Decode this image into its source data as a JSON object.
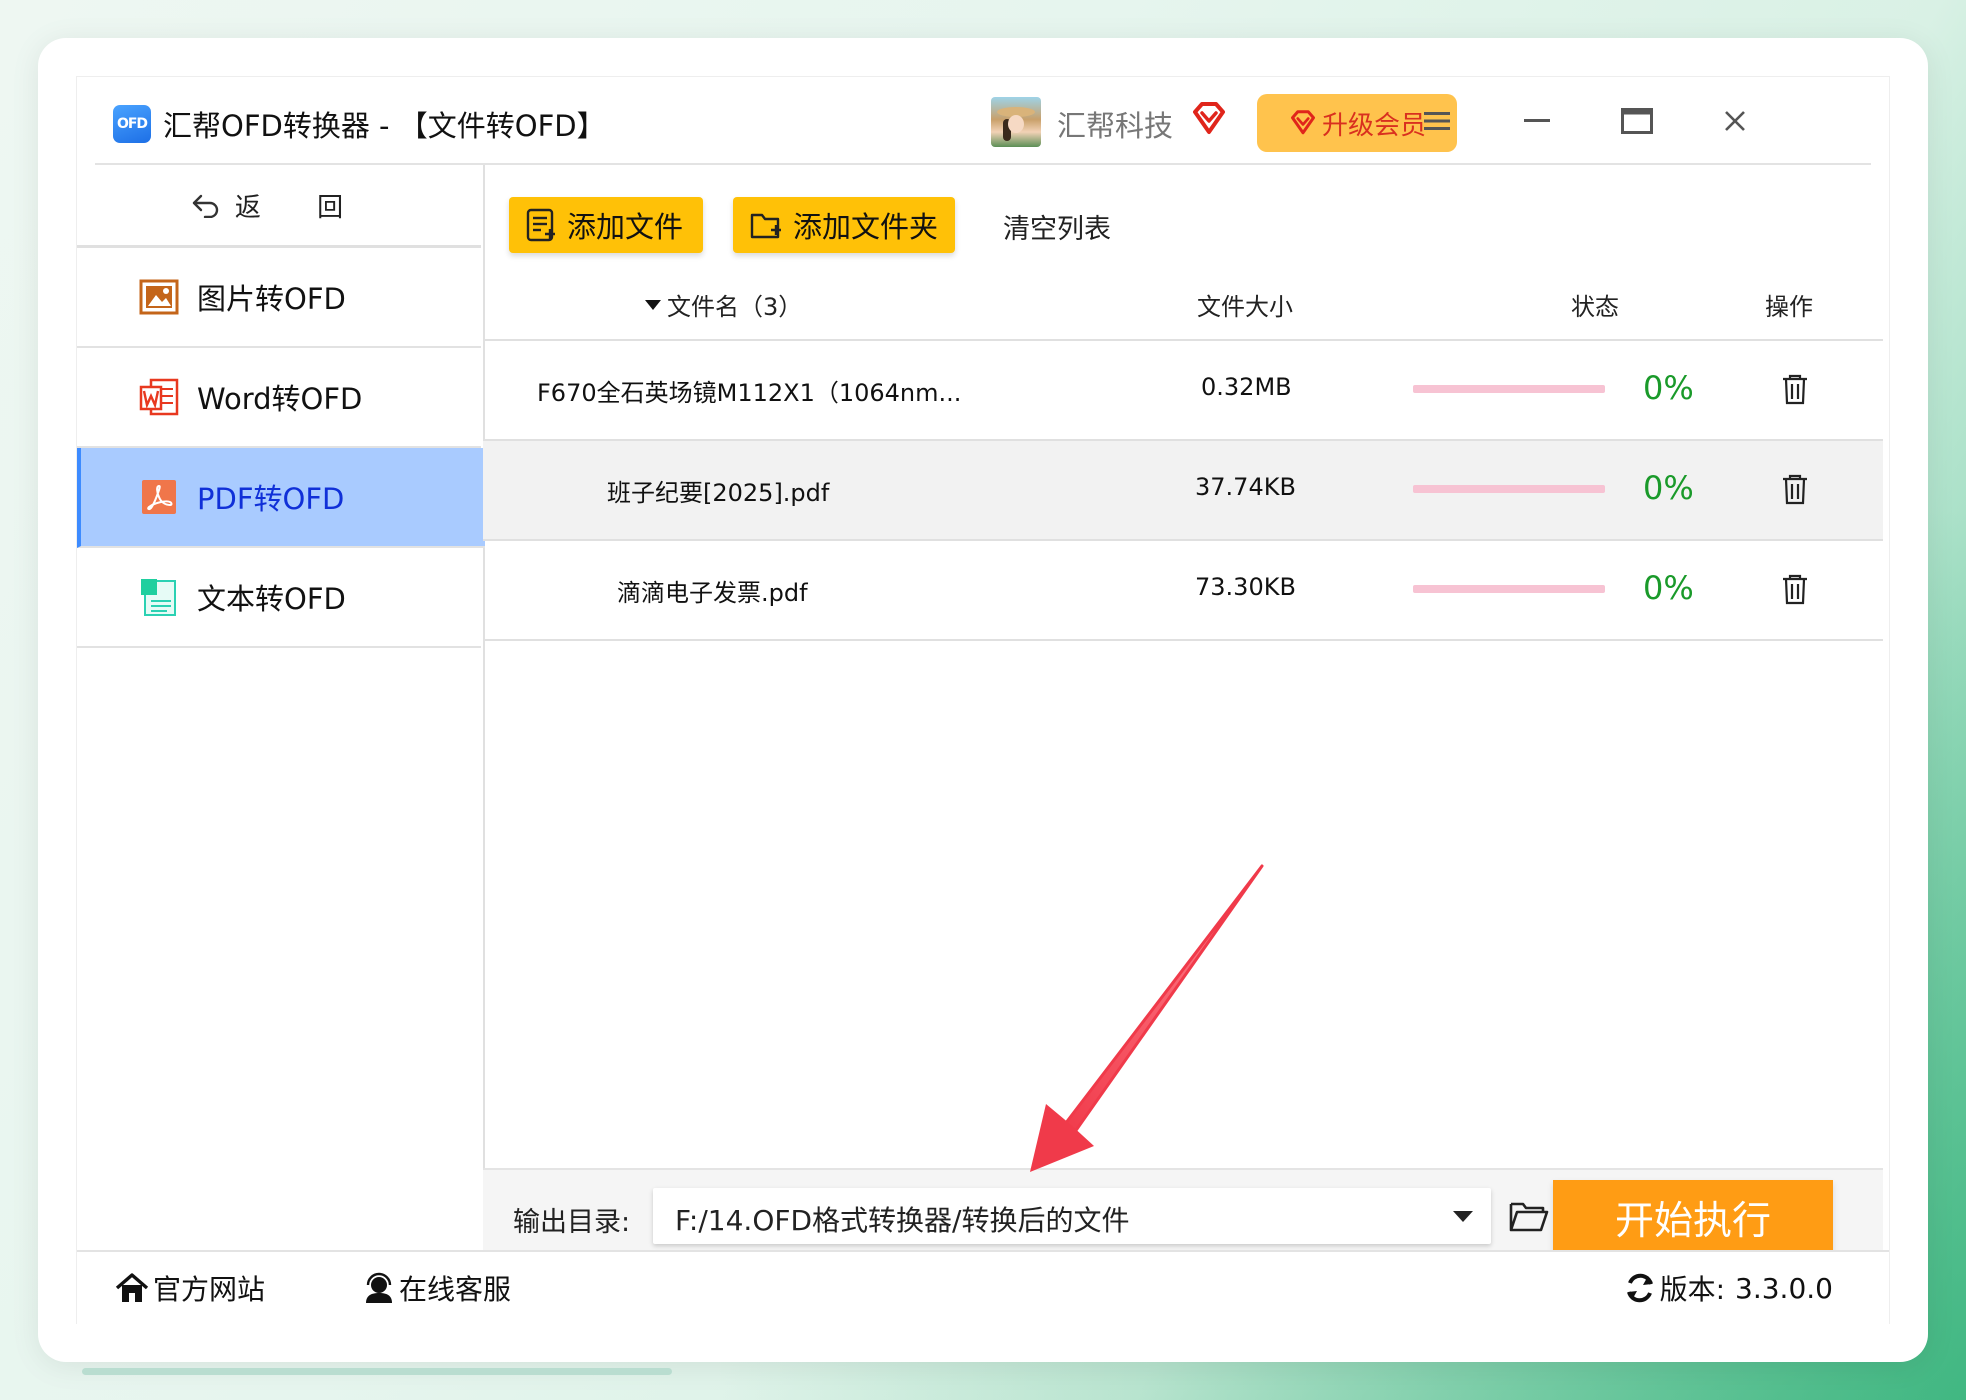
{
  "app": {
    "logo_text": "OFD",
    "title": "汇帮OFD转换器 - 【文件转OFD】"
  },
  "user": {
    "name": "汇帮科技",
    "upgrade_label": "升级会员",
    "vip_color": "#e0251b"
  },
  "window_controls": [
    "menu-icon",
    "minimize-icon",
    "maximize-icon",
    "close-icon"
  ],
  "sidebar": {
    "back_label": "返 回",
    "items": [
      {
        "label": "图片转OFD",
        "icon": "image-icon",
        "active": false
      },
      {
        "label": "Word转OFD",
        "icon": "word-icon",
        "active": false
      },
      {
        "label": "PDF转OFD",
        "icon": "pdf-icon",
        "active": true
      },
      {
        "label": "文本转OFD",
        "icon": "text-doc-icon",
        "active": false
      }
    ]
  },
  "toolbar": {
    "add_file": "添加文件",
    "add_folder": "添加文件夹",
    "clear_list": "清空列表"
  },
  "table": {
    "headers": {
      "name": "文件名（3）",
      "size": "文件大小",
      "status": "状态",
      "action": "操作"
    },
    "rows": [
      {
        "name": "F670全石英场镜M112X1（1064nm...",
        "size": "0.32MB",
        "progress": 0,
        "percent": "0%"
      },
      {
        "name": "班子纪要[2025].pdf",
        "size": "37.74KB",
        "progress": 0,
        "percent": "0%"
      },
      {
        "name": "滴滴电子发票.pdf",
        "size": "73.30KB",
        "progress": 0,
        "percent": "0%"
      }
    ]
  },
  "output": {
    "label": "输出目录:",
    "path": "F:/14.OFD格式转换器/转换后的文件",
    "start_label": "开始执行"
  },
  "footer": {
    "website": "官方网站",
    "support": "在线客服",
    "version_label": "版本:",
    "version": "3.3.0.0"
  },
  "colors": {
    "accent_yellow": "#ffc107",
    "start_orange": "#ff9c14",
    "active_nav": "#a9cbff",
    "percent_green": "#1a9a2a",
    "progress_track": "#f7c3d3",
    "annotation_arrow": "#f03a4a"
  }
}
